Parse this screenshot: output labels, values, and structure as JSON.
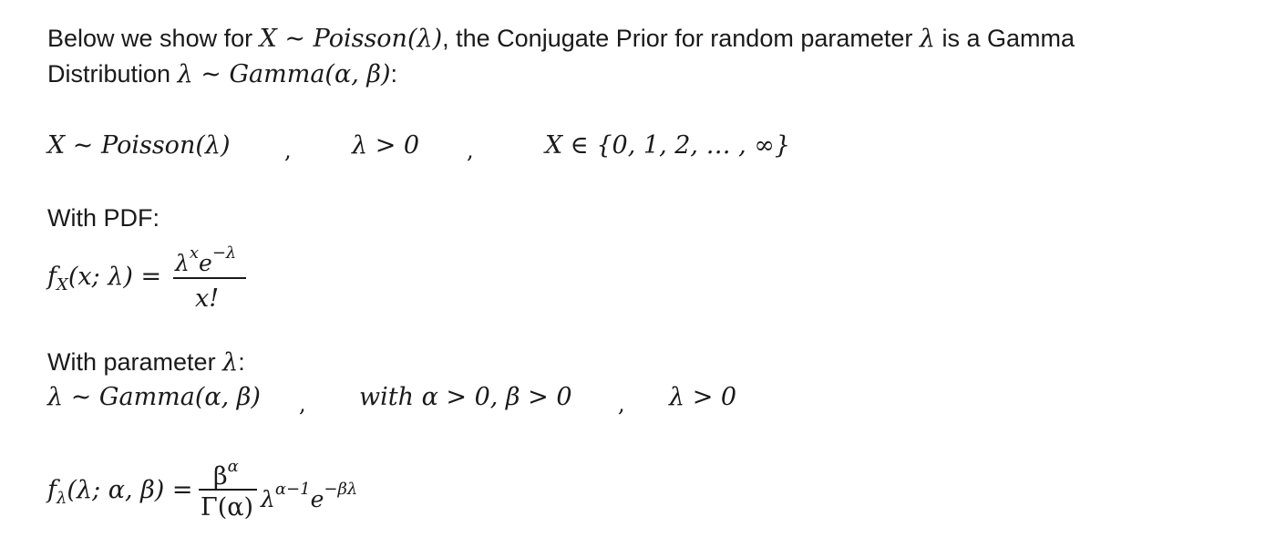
{
  "intro": {
    "line1_prefix": "Below we show for ",
    "line1_math": "X ~ Poisson(λ)",
    "line1_mid": ", the Conjugate Prior for random parameter ",
    "line1_lambda": "λ",
    "line1_suffix": " is a Gamma",
    "line2_prefix": "Distribution ",
    "line2_math": "λ ~ Gamma(α, β)",
    "line2_suffix": ":"
  },
  "poisson_line": {
    "dist": "X ~ Poisson(λ)",
    "sep1": ",",
    "cond": "λ > 0",
    "sep2": ",",
    "support": "X ∈ {0, 1, 2, … , ∞}"
  },
  "pdf_section": {
    "heading": "With PDF:",
    "lhs_f": "f",
    "lhs_sub": "X",
    "lhs_args": "(x; λ) =",
    "num_base": "λ",
    "num_exp1": "x",
    "num_e": "e",
    "num_exp2": "−λ",
    "den": "x!"
  },
  "param_section": {
    "heading_prefix": "With parameter ",
    "heading_lambda": "λ",
    "heading_suffix": ":",
    "dist": "λ ~ Gamma(α, β)",
    "sep1": ",",
    "cond": "with α > 0,   β > 0",
    "sep2": ",",
    "cond2": "λ > 0"
  },
  "gamma_pdf": {
    "lhs_f": "f",
    "lhs_sub": "λ",
    "lhs_args": "(λ; α, β) =",
    "num_base": "β",
    "num_exp": "α",
    "den": "Γ(α)",
    "tail_base": "λ",
    "tail_exp1": "α−1",
    "tail_e": "e",
    "tail_exp2": "−βλ"
  }
}
